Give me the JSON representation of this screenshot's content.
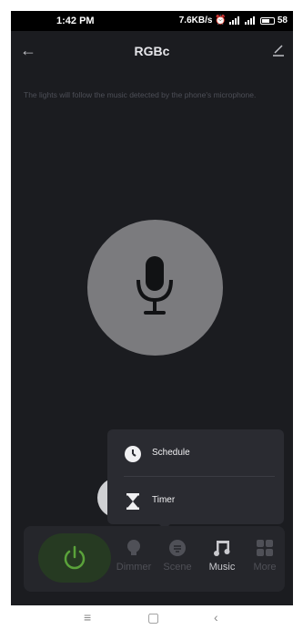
{
  "status_bar": {
    "time": "1:42 PM",
    "network_speed": "7.6KB/s",
    "battery": "58"
  },
  "header": {
    "title": "RGBc"
  },
  "hint": "The lights will follow the music detected by the phone's microphone.",
  "popup_menu": {
    "items": [
      {
        "label": "Schedule",
        "icon": "clock-icon"
      },
      {
        "label": "Timer",
        "icon": "hourglass-icon"
      }
    ]
  },
  "bottom_nav": {
    "items": [
      {
        "label": "Dimmer",
        "icon": "bulb-icon",
        "active": false
      },
      {
        "label": "Scene",
        "icon": "scene-icon",
        "active": false
      },
      {
        "label": "Music",
        "icon": "music-note-icon",
        "active": true
      },
      {
        "label": "More",
        "icon": "grid-icon",
        "active": false
      }
    ]
  },
  "colors": {
    "background": "#1b1c20",
    "mic_circle": "#7b7b7e",
    "power_accent": "#5aa23a",
    "popup": "#2a2b31"
  }
}
